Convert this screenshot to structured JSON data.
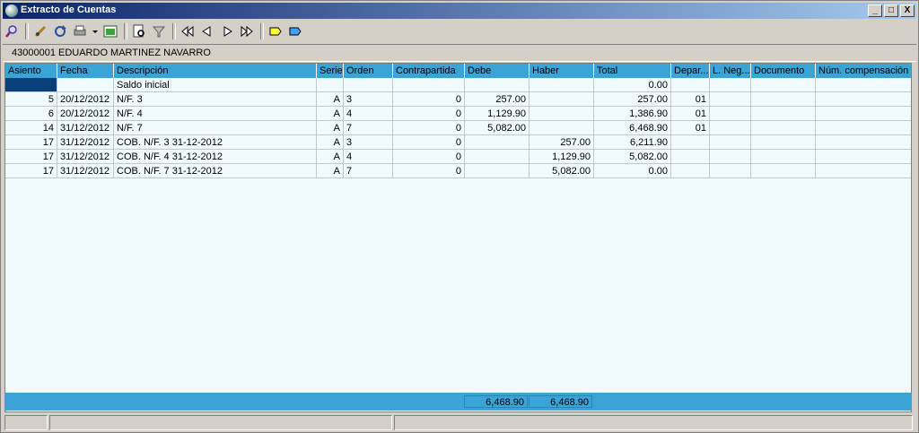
{
  "window": {
    "title": "Extracto de Cuentas",
    "btn_min": "_",
    "btn_max": "□",
    "btn_close": "X"
  },
  "toolbar": {
    "icons": [
      "search-icon",
      "edit-icon",
      "refresh-icon",
      "print-icon",
      "dropdown-arrow-icon",
      "export-excel-icon",
      "preview-icon",
      "filter-icon",
      "first-record-icon",
      "previous-record-icon",
      "next-record-icon",
      "last-record-icon",
      "yellow-label-icon",
      "blue-label-icon"
    ]
  },
  "account": {
    "label": "43000001  EDUARDO MARTINEZ NAVARRO"
  },
  "table": {
    "headers": [
      "Asiento",
      "Fecha",
      "Descripción",
      "Serie",
      "Orden",
      "Contrapartida",
      "Debe",
      "Haber",
      "Total",
      "Depar...",
      "L. Neg...",
      "Documento",
      "Núm. compensación"
    ],
    "rows": [
      [
        "",
        "",
        "Saldo inicial",
        "",
        "",
        "",
        "",
        "",
        "0.00",
        "",
        "",
        "",
        ""
      ],
      [
        "5",
        "20/12/2012",
        "N/F. 3",
        "A",
        "3",
        "0",
        "257.00",
        "",
        "257.00",
        "01",
        "",
        "",
        ""
      ],
      [
        "6",
        "20/12/2012",
        "N/F. 4",
        "A",
        "4",
        "0",
        "1,129.90",
        "",
        "1,386.90",
        "01",
        "",
        "",
        ""
      ],
      [
        "14",
        "31/12/2012",
        "N/F. 7",
        "A",
        "7",
        "0",
        "5,082.00",
        "",
        "6,468.90",
        "01",
        "",
        "",
        ""
      ],
      [
        "17",
        "31/12/2012",
        "COB. N/F. 3 31-12-2012",
        "A",
        "3",
        "0",
        "",
        "257.00",
        "6,211.90",
        "",
        "",
        "",
        ""
      ],
      [
        "17",
        "31/12/2012",
        "COB. N/F. 4 31-12-2012",
        "A",
        "4",
        "0",
        "",
        "1,129.90",
        "5,082.00",
        "",
        "",
        "",
        ""
      ],
      [
        "17",
        "31/12/2012",
        "COB. N/F. 7 31-12-2012",
        "A",
        "7",
        "0",
        "",
        "5,082.00",
        "0.00",
        "",
        "",
        "",
        ""
      ]
    ]
  },
  "totals": {
    "debe": "6,468.90",
    "haber": "6,468.90"
  },
  "colors": {
    "header": "#3ba4d6",
    "grid_bg": "#f0fbfd",
    "selected": "#0a3f7a"
  }
}
